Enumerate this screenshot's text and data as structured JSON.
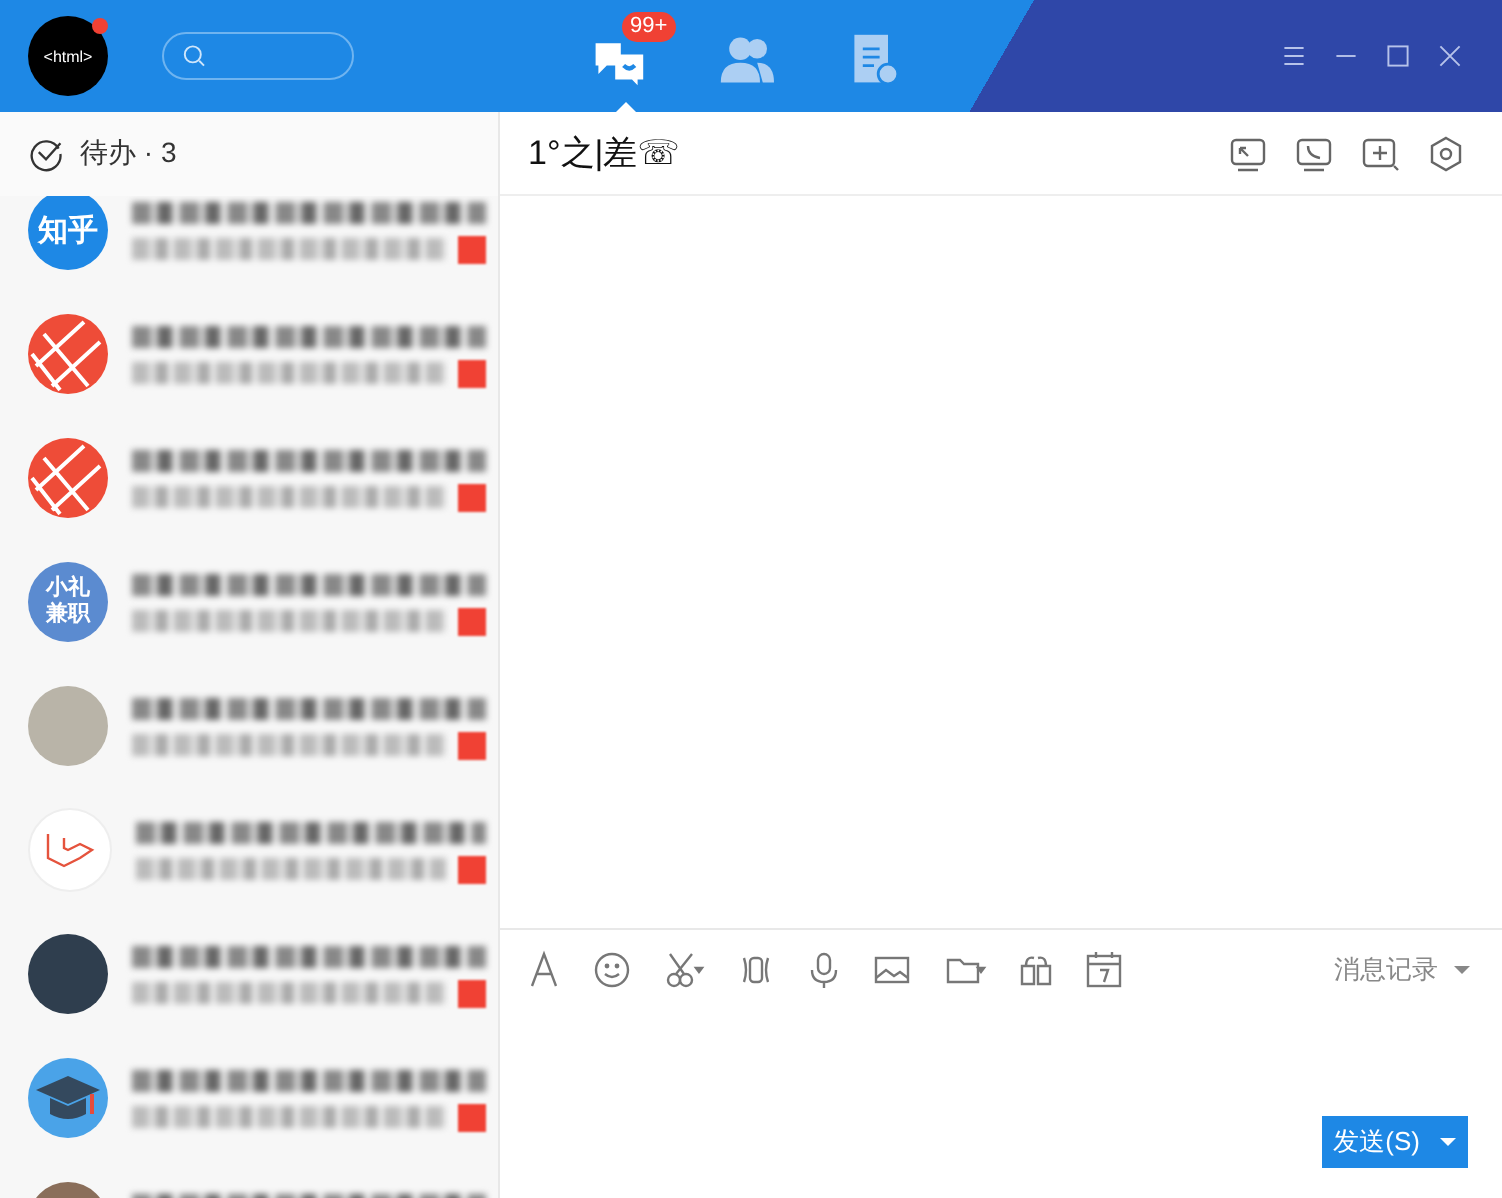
{
  "header": {
    "profile_logo_text": "<html>",
    "profile_online": true,
    "tabs": [
      {
        "kind": "messages",
        "selected": true,
        "badge": "99+"
      },
      {
        "kind": "contacts",
        "selected": false
      },
      {
        "kind": "documents",
        "selected": false
      }
    ]
  },
  "todo": {
    "label": "待办 · 3"
  },
  "conversations": [
    {
      "avatar": {
        "kind": "text",
        "text": "知乎",
        "color": "#1e88e5"
      },
      "unread": true
    },
    {
      "avatar": {
        "kind": "grid",
        "color": "#ee4c38"
      },
      "unread": true
    },
    {
      "avatar": {
        "kind": "grid",
        "color": "#ee4c38"
      },
      "unread": true
    },
    {
      "avatar": {
        "kind": "text",
        "text": "小礼兼职",
        "color": "#5b8bd0"
      },
      "unread": true
    },
    {
      "avatar": {
        "kind": "photo",
        "color": "#b9b4a8"
      },
      "unread": true
    },
    {
      "avatar": {
        "kind": "logo",
        "color": "#ffffff"
      },
      "unread": true
    },
    {
      "avatar": {
        "kind": "photo",
        "color": "#2f3e4e"
      },
      "unread": true
    },
    {
      "avatar": {
        "kind": "cap",
        "color": "#4aa3e8"
      },
      "unread": true
    },
    {
      "avatar": {
        "kind": "photo",
        "color": "#8a6e5a"
      },
      "unread": false
    }
  ],
  "chat": {
    "title": "1°之|差☏",
    "history_label": "消息记录",
    "send_label": "发送(S)"
  }
}
